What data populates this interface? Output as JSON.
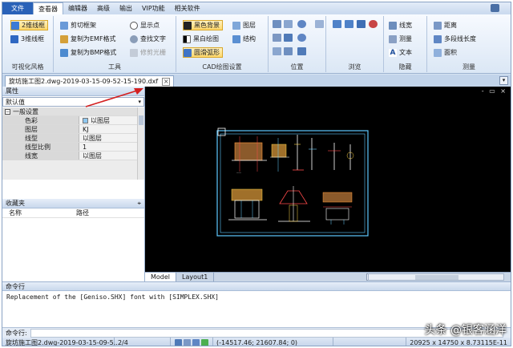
{
  "menu": {
    "file": "文件",
    "items": [
      "查看器",
      "编辑器",
      "高级",
      "输出",
      "VIP功能",
      "相关软件"
    ]
  },
  "ribbon": {
    "visual_style": {
      "label": "可视化风格",
      "buttons": [
        "2维线框",
        "3维线框"
      ]
    },
    "tools": {
      "label": "工具",
      "buttons": [
        "剪切框架",
        "复制为EMF格式",
        "复制为BMP格式",
        "显示点",
        "查找文字",
        "修剪光栅"
      ]
    },
    "cad_settings": {
      "label": "CAD绘图设置",
      "buttons": [
        "黑色背景",
        "黑白绘图",
        "圆滑弧形",
        "图层",
        "结构"
      ]
    },
    "position": {
      "label": "位置"
    },
    "browse": {
      "label": "浏览"
    },
    "hide": {
      "label": "隐藏",
      "buttons": [
        "线宽",
        "测量",
        "文本"
      ]
    },
    "measure": {
      "label": "测量",
      "buttons": [
        "距离",
        "多段线长度",
        "面积"
      ]
    }
  },
  "document_tab": {
    "filename": "旋坊施工图2.dwg-2019-03-15-09-52-15-190.dxf",
    "close": "×"
  },
  "properties": {
    "title": "属性",
    "pin": "⌖",
    "selector": "默认值",
    "category": "一般设置",
    "rows": [
      {
        "key": "色彩",
        "value": "以图层"
      },
      {
        "key": "图层",
        "value": "KJ"
      },
      {
        "key": "线型",
        "value": "以图层"
      },
      {
        "key": "线型比例",
        "value": "1"
      },
      {
        "key": "线宽",
        "value": "以图层"
      }
    ]
  },
  "favorites": {
    "title": "收藏夹",
    "columns": [
      "名称",
      "路径"
    ]
  },
  "canvas": {
    "window_controls": "- ▭ ×",
    "tabs": [
      "Model",
      "Layout1"
    ]
  },
  "command": {
    "title": "命令行",
    "output": "Replacement of the [Geniso.SHX] font with [SIMPLEX.SHX]",
    "prompt": "命令行:"
  },
  "status": {
    "file": "旋坊施工图2.dwg-2019-03-15-09-5...",
    "page": "2/4",
    "coords": "(-14517.46; 21607.84; 0)",
    "size": "20925 x 14750 x 8.73115E-11"
  },
  "watermark": "头条 @银客涵洋",
  "colors": {
    "accent": "#2a62b8",
    "selection": "#ffd86b",
    "canvas": "#000000",
    "arrow": "#d42020"
  }
}
